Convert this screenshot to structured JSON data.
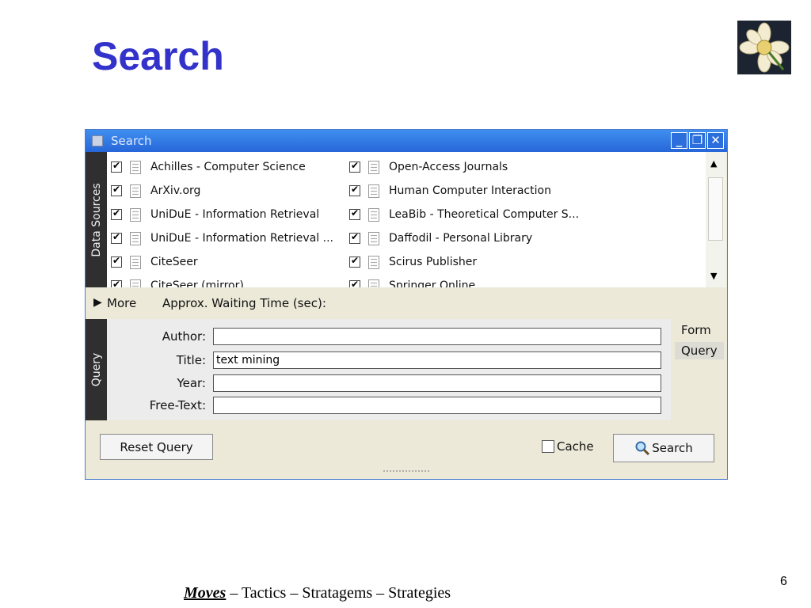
{
  "slide": {
    "title": "Search",
    "page_number": "6",
    "footer": {
      "moves": "Moves",
      "rest": " – Tactics – Stratagems – Strategies"
    }
  },
  "window": {
    "title": "Search",
    "controls": {
      "minimize": "_",
      "restore": "❐",
      "close": "✕"
    }
  },
  "data_sources": {
    "label": "Data Sources",
    "left": [
      {
        "label": "Achilles - Computer Science",
        "checked": true
      },
      {
        "label": "ArXiv.org",
        "checked": true
      },
      {
        "label": "UniDuE - Information Retrieval",
        "checked": true
      },
      {
        "label": "UniDuE - Information Retrieval ...",
        "checked": true
      },
      {
        "label": "CiteSeer",
        "checked": true
      },
      {
        "label": "CiteSeer (mirror)",
        "checked": true
      }
    ],
    "right": [
      {
        "label": "Open-Access Journals",
        "checked": true
      },
      {
        "label": "Human Computer Interaction",
        "checked": true
      },
      {
        "label": "LeaBib - Theoretical Computer S...",
        "checked": true
      },
      {
        "label": "Daffodil - Personal Library",
        "checked": true
      },
      {
        "label": "Scirus Publisher",
        "checked": true
      },
      {
        "label": "Springer Online",
        "checked": true
      }
    ]
  },
  "more": {
    "label": "More",
    "waiting_label": "Approx. Waiting Time (sec):"
  },
  "query": {
    "label": "Query",
    "fields": [
      {
        "label": "Author:",
        "value": ""
      },
      {
        "label": "Title:",
        "value": "text mining"
      },
      {
        "label": "Year:",
        "value": ""
      },
      {
        "label": "Free-Text:",
        "value": ""
      }
    ],
    "tabs": [
      {
        "label": "Form",
        "active": false
      },
      {
        "label": "Query",
        "active": true
      }
    ]
  },
  "actions": {
    "reset": "Reset Query",
    "cache_label": "Cache",
    "cache_checked": false,
    "search": "Search"
  },
  "colors": {
    "title": "#3333cc",
    "titlebar": "#2766d8",
    "side_bar": "#2f2f2f"
  },
  "icons": [
    "window-icon",
    "document-icon",
    "checkbox-icon",
    "scroll-up-icon",
    "scroll-down-icon",
    "expand-triangle-icon",
    "magnifier-icon",
    "daffodil-logo"
  ]
}
